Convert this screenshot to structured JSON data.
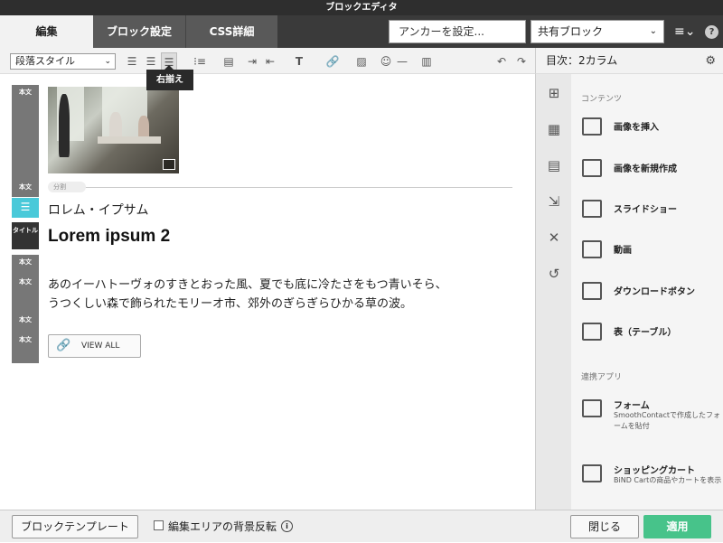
{
  "window": {
    "title": "ブロックエディタ"
  },
  "tabs": [
    {
      "label": "編集"
    },
    {
      "label": "ブロック設定"
    },
    {
      "label": "CSS詳細"
    }
  ],
  "header": {
    "anchor_placeholder": "アンカーを設定...",
    "shared_block_value": "共有ブロック",
    "help_label": "?"
  },
  "toolbar": {
    "paragraph_style": "段落スタイル",
    "tooltip": "右揃え"
  },
  "editor": {
    "divider_label": "分割",
    "subheading": "ロレム・イプサム",
    "title": "Lorem ipsum 2",
    "paragraph_line1": "あのイーハトーヴォのすきとおった風、夏でも底に冷たさをもつ青いそら、",
    "paragraph_line2": "うつくしい森で飾られたモリーオ市、郊外のぎらぎらひかる草の波。",
    "button_label": "VIEW ALL",
    "gutter_labels": [
      "本文",
      "本文",
      "タイトル",
      "本文",
      "本文",
      "本文",
      "本文"
    ]
  },
  "sidebar": {
    "heading": "目次：2カラム",
    "section_contents": "コンテンツ",
    "section_apps": "連携アプリ",
    "items": [
      {
        "label": "画像を挿入"
      },
      {
        "label": "画像を新規作成"
      },
      {
        "label": "スライドショー"
      },
      {
        "label": "動画"
      },
      {
        "label": "ダウンロードボタン"
      },
      {
        "label": "表（テーブル）"
      }
    ],
    "apps": [
      {
        "label": "フォーム",
        "desc": "SmoothContactで作成したフォームを貼付"
      },
      {
        "label": "ショッピングカート",
        "desc": "BiND Cartの商品やカートを表示"
      }
    ]
  },
  "footer": {
    "template_button": "ブロックテンプレート",
    "invert_label": "編集エリアの背景反転",
    "close_button": "閉じる",
    "apply_button": "適用"
  },
  "colors": {
    "accent": "#47c38a",
    "selected_gutter": "#49c9d9",
    "header_bg": "#3a3a3a"
  }
}
